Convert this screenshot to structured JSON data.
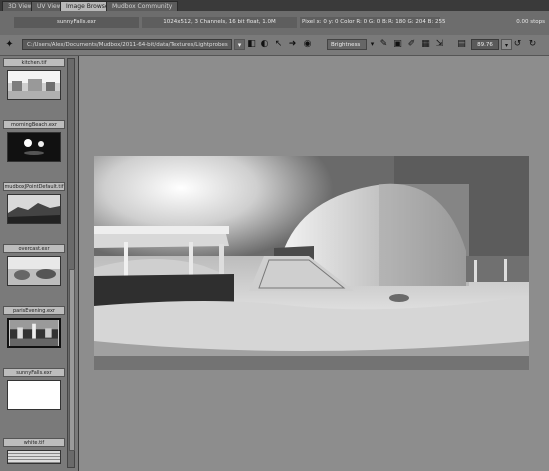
{
  "tabs": [
    {
      "label": "3D View"
    },
    {
      "label": "UV View"
    },
    {
      "label": "Image Browser"
    },
    {
      "label": "Mudbox Community"
    }
  ],
  "info": {
    "filename": "sunnyFalls.exr",
    "file_details": "1024x512, 3 Channels, 16 bit float, 1.0M",
    "pixel_info": "Pixel x: 0 y: 0 Color R: 0 G: 0 B: 0",
    "color_values": "R: 180 G: 204 B: 255",
    "right_value": "0.00 stops"
  },
  "toolbar": {
    "path": "C:/Users/Alex/Documents/Mudbox/2011-64-bit/data/Textures/Lightprobes",
    "mode": "Brightness",
    "zoom": "89.76"
  },
  "thumbnails": [
    {
      "label": "kitchen.tif"
    },
    {
      "label": "morningBeach.exr"
    },
    {
      "label": "mudboxJPointDefault.tif"
    },
    {
      "label": "overcast.exr"
    },
    {
      "label": "parisEvening.exr"
    },
    {
      "label": "sunnyFalls.exr"
    },
    {
      "label": "white.tif"
    }
  ]
}
